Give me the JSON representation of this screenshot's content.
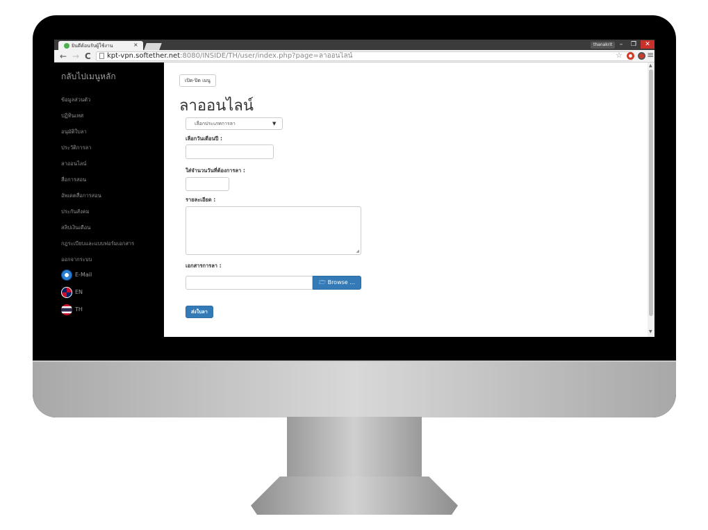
{
  "browser": {
    "tab_title": "ยินดีต้อนรับผู้ใช้งาน",
    "tab_close": "×",
    "user_badge": "thanakrit",
    "win_min": "–",
    "win_max": "❐",
    "win_close": "✕",
    "url_host": "kpt-vpn.softether.net",
    "url_path": ":8080/INSIDE/TH/user/index.php?page=ลาออนไลน์",
    "back_icon": "←",
    "forward_icon": "→",
    "reload_icon": "C",
    "star_icon": "☆",
    "menu_icon": "≡"
  },
  "sidebar": {
    "home_label": "กลับไปเมนูหลัก",
    "items": [
      "ข้อมูลส่วนตัว",
      "ปฏิทินเทศ",
      "อนุมัติใบลา",
      "ประวัติการลา",
      "ลาออนไลน์",
      "สื่อการสอน",
      "อัพเดตสื่อการสอน",
      "ประกันสังคม",
      "สลิปเงินเดือน",
      "กฎระเบียบและแบบฟอร์มเอกสาร",
      "ออกจากระบบ"
    ],
    "links": [
      {
        "label": "E-Mail",
        "icon": "email-icon"
      },
      {
        "label": "EN",
        "icon": "uk-flag-icon"
      },
      {
        "label": "TH",
        "icon": "thai-flag-icon"
      }
    ]
  },
  "content": {
    "toggle_label": "เปิด-ปิด เมนู",
    "page_title": "ลาออนไลน์",
    "leave_type_selected": "เลือกประเภทการลา",
    "date_label": "เลือกวันเดือนปี :",
    "days_label": "ใส่จำนวนวันที่ต้องการลา :",
    "detail_label": "รายละเอียด :",
    "document_label": "เอกสารการลา :",
    "browse_label": "Browse ...",
    "browse_icon": "folder-open-icon",
    "submit_label": "ส่งใบลา"
  },
  "colors": {
    "primary": "#337ab7",
    "sidebar_bg": "#000000",
    "close_button": "#c9302c"
  }
}
